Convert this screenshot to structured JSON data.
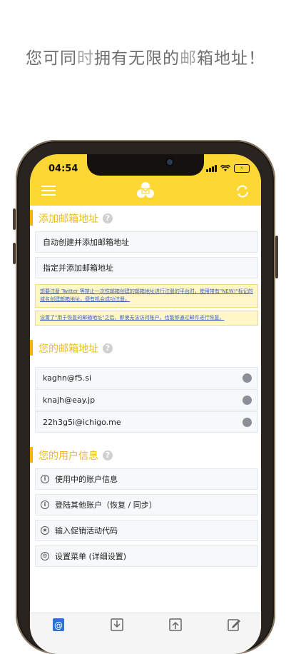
{
  "headline": {
    "part1": "您可同",
    "part2": "时",
    "part3": "拥",
    "part4": "有无限的",
    "part5": "邮",
    "part6": "箱地址！"
  },
  "status": {
    "time": "04:54"
  },
  "colors": {
    "accent": "#fdd835",
    "title": "#e8bd1e"
  },
  "add_section": {
    "title": "添加邮箱地址",
    "auto_create": "自动创建并添加邮箱地址",
    "specify_add": "指定并添加邮箱地址",
    "note1": "想要注册 Twitter 等禁止一次性邮箱创建的邮箱地址进行注册的平台时，使用带有\"NEW!\"标记的域名创建邮箱地址，便有机会成功注册。",
    "note2": "设置了\"用于恢复的邮箱地址\"之后，即使无法访问账户，也能够通过邮件进行恢复。"
  },
  "address_section": {
    "title": "您的邮箱地址",
    "addresses": [
      "kaghn@f5.si",
      "knajh@eay.jp",
      "22h3g5i@ichigo.me"
    ]
  },
  "user_section": {
    "title": "您的用户信息",
    "items": [
      {
        "label": "使用中的账户信息",
        "icon": "info-icon",
        "glyph": "i"
      },
      {
        "label": "登陆其他账户（恢复 / 同步）",
        "icon": "info-icon",
        "glyph": "i"
      },
      {
        "label": "输入促销活动代码",
        "icon": "star-icon",
        "glyph": "★"
      },
      {
        "label": "设置菜单 (详细设置)",
        "icon": "gear-icon",
        "glyph": "⚙"
      }
    ]
  }
}
